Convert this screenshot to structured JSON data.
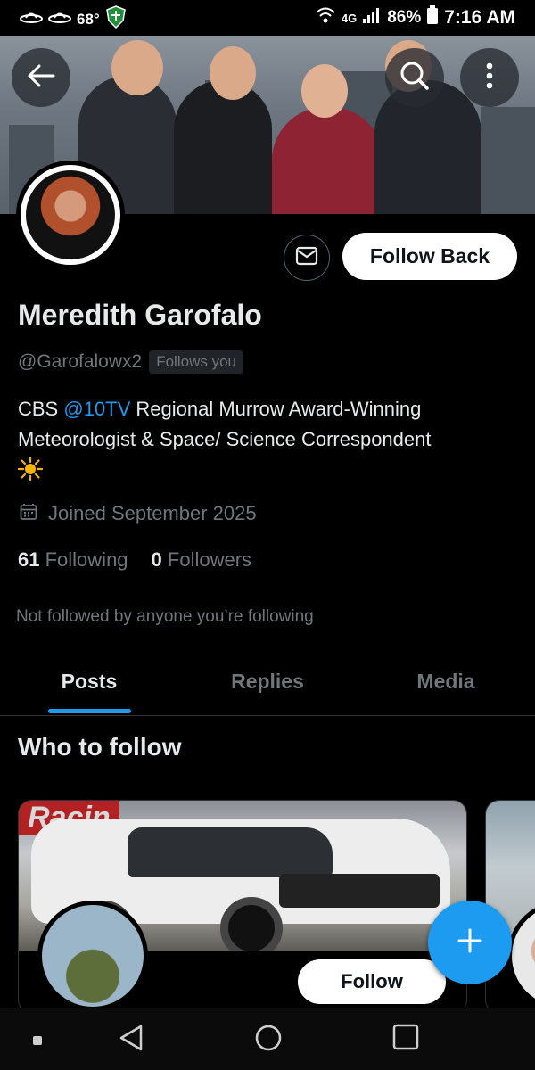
{
  "status_bar": {
    "temperature": "68°",
    "network": "4G",
    "battery": "86%",
    "time": "7:16 AM"
  },
  "banner": {
    "back_icon": "arrow-left-icon",
    "search_icon": "search-icon",
    "more_icon": "more-vertical-icon"
  },
  "profile": {
    "name": "Meredith Garofalo",
    "handle": "@Garofalowx2",
    "follows_you": "Follows you",
    "bio_prefix": "CBS ",
    "bio_mention": "@10TV",
    "bio_suffix": " Regional Murrow Award-Winning Meteorologist & Space/ Science Correspondent",
    "joined": "Joined September 2025",
    "following_count": "61",
    "following_label": "Following",
    "followers_count": "0",
    "followers_label": "Followers",
    "not_followed": "Not followed by anyone you’re following",
    "message_icon": "envelope-icon",
    "follow_back_label": "Follow Back"
  },
  "tabs": [
    {
      "label": "Posts",
      "active": true
    },
    {
      "label": "Replies",
      "active": false
    },
    {
      "label": "Media",
      "active": false
    }
  ],
  "who_to_follow": {
    "title": "Who to follow",
    "card_follow_label": "Follow"
  },
  "colors": {
    "accent": "#1d9bf0",
    "background": "#000000",
    "text_primary": "#e7e9ea",
    "text_secondary": "#71767b"
  }
}
